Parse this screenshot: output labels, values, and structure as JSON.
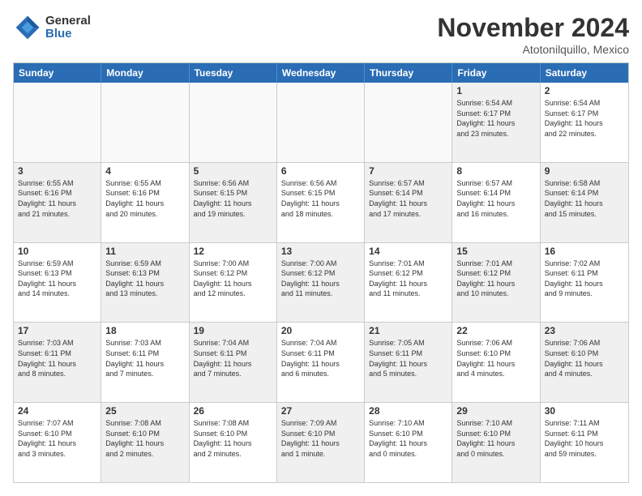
{
  "logo": {
    "general": "General",
    "blue": "Blue"
  },
  "title": "November 2024",
  "location": "Atotonilquillo, Mexico",
  "weekdays": [
    "Sunday",
    "Monday",
    "Tuesday",
    "Wednesday",
    "Thursday",
    "Friday",
    "Saturday"
  ],
  "rows": [
    [
      {
        "day": "",
        "info": "",
        "empty": true
      },
      {
        "day": "",
        "info": "",
        "empty": true
      },
      {
        "day": "",
        "info": "",
        "empty": true
      },
      {
        "day": "",
        "info": "",
        "empty": true
      },
      {
        "day": "",
        "info": "",
        "empty": true
      },
      {
        "day": "1",
        "info": "Sunrise: 6:54 AM\nSunset: 6:17 PM\nDaylight: 11 hours\nand 23 minutes.",
        "shaded": true
      },
      {
        "day": "2",
        "info": "Sunrise: 6:54 AM\nSunset: 6:17 PM\nDaylight: 11 hours\nand 22 minutes.",
        "shaded": false
      }
    ],
    [
      {
        "day": "3",
        "info": "Sunrise: 6:55 AM\nSunset: 6:16 PM\nDaylight: 11 hours\nand 21 minutes.",
        "shaded": true
      },
      {
        "day": "4",
        "info": "Sunrise: 6:55 AM\nSunset: 6:16 PM\nDaylight: 11 hours\nand 20 minutes.",
        "shaded": false
      },
      {
        "day": "5",
        "info": "Sunrise: 6:56 AM\nSunset: 6:15 PM\nDaylight: 11 hours\nand 19 minutes.",
        "shaded": true
      },
      {
        "day": "6",
        "info": "Sunrise: 6:56 AM\nSunset: 6:15 PM\nDaylight: 11 hours\nand 18 minutes.",
        "shaded": false
      },
      {
        "day": "7",
        "info": "Sunrise: 6:57 AM\nSunset: 6:14 PM\nDaylight: 11 hours\nand 17 minutes.",
        "shaded": true
      },
      {
        "day": "8",
        "info": "Sunrise: 6:57 AM\nSunset: 6:14 PM\nDaylight: 11 hours\nand 16 minutes.",
        "shaded": false
      },
      {
        "day": "9",
        "info": "Sunrise: 6:58 AM\nSunset: 6:14 PM\nDaylight: 11 hours\nand 15 minutes.",
        "shaded": true
      }
    ],
    [
      {
        "day": "10",
        "info": "Sunrise: 6:59 AM\nSunset: 6:13 PM\nDaylight: 11 hours\nand 14 minutes.",
        "shaded": false
      },
      {
        "day": "11",
        "info": "Sunrise: 6:59 AM\nSunset: 6:13 PM\nDaylight: 11 hours\nand 13 minutes.",
        "shaded": true
      },
      {
        "day": "12",
        "info": "Sunrise: 7:00 AM\nSunset: 6:12 PM\nDaylight: 11 hours\nand 12 minutes.",
        "shaded": false
      },
      {
        "day": "13",
        "info": "Sunrise: 7:00 AM\nSunset: 6:12 PM\nDaylight: 11 hours\nand 11 minutes.",
        "shaded": true
      },
      {
        "day": "14",
        "info": "Sunrise: 7:01 AM\nSunset: 6:12 PM\nDaylight: 11 hours\nand 11 minutes.",
        "shaded": false
      },
      {
        "day": "15",
        "info": "Sunrise: 7:01 AM\nSunset: 6:12 PM\nDaylight: 11 hours\nand 10 minutes.",
        "shaded": true
      },
      {
        "day": "16",
        "info": "Sunrise: 7:02 AM\nSunset: 6:11 PM\nDaylight: 11 hours\nand 9 minutes.",
        "shaded": false
      }
    ],
    [
      {
        "day": "17",
        "info": "Sunrise: 7:03 AM\nSunset: 6:11 PM\nDaylight: 11 hours\nand 8 minutes.",
        "shaded": true
      },
      {
        "day": "18",
        "info": "Sunrise: 7:03 AM\nSunset: 6:11 PM\nDaylight: 11 hours\nand 7 minutes.",
        "shaded": false
      },
      {
        "day": "19",
        "info": "Sunrise: 7:04 AM\nSunset: 6:11 PM\nDaylight: 11 hours\nand 7 minutes.",
        "shaded": true
      },
      {
        "day": "20",
        "info": "Sunrise: 7:04 AM\nSunset: 6:11 PM\nDaylight: 11 hours\nand 6 minutes.",
        "shaded": false
      },
      {
        "day": "21",
        "info": "Sunrise: 7:05 AM\nSunset: 6:11 PM\nDaylight: 11 hours\nand 5 minutes.",
        "shaded": true
      },
      {
        "day": "22",
        "info": "Sunrise: 7:06 AM\nSunset: 6:10 PM\nDaylight: 11 hours\nand 4 minutes.",
        "shaded": false
      },
      {
        "day": "23",
        "info": "Sunrise: 7:06 AM\nSunset: 6:10 PM\nDaylight: 11 hours\nand 4 minutes.",
        "shaded": true
      }
    ],
    [
      {
        "day": "24",
        "info": "Sunrise: 7:07 AM\nSunset: 6:10 PM\nDaylight: 11 hours\nand 3 minutes.",
        "shaded": false
      },
      {
        "day": "25",
        "info": "Sunrise: 7:08 AM\nSunset: 6:10 PM\nDaylight: 11 hours\nand 2 minutes.",
        "shaded": true
      },
      {
        "day": "26",
        "info": "Sunrise: 7:08 AM\nSunset: 6:10 PM\nDaylight: 11 hours\nand 2 minutes.",
        "shaded": false
      },
      {
        "day": "27",
        "info": "Sunrise: 7:09 AM\nSunset: 6:10 PM\nDaylight: 11 hours\nand 1 minute.",
        "shaded": true
      },
      {
        "day": "28",
        "info": "Sunrise: 7:10 AM\nSunset: 6:10 PM\nDaylight: 11 hours\nand 0 minutes.",
        "shaded": false
      },
      {
        "day": "29",
        "info": "Sunrise: 7:10 AM\nSunset: 6:10 PM\nDaylight: 11 hours\nand 0 minutes.",
        "shaded": true
      },
      {
        "day": "30",
        "info": "Sunrise: 7:11 AM\nSunset: 6:11 PM\nDaylight: 10 hours\nand 59 minutes.",
        "shaded": false
      }
    ]
  ]
}
